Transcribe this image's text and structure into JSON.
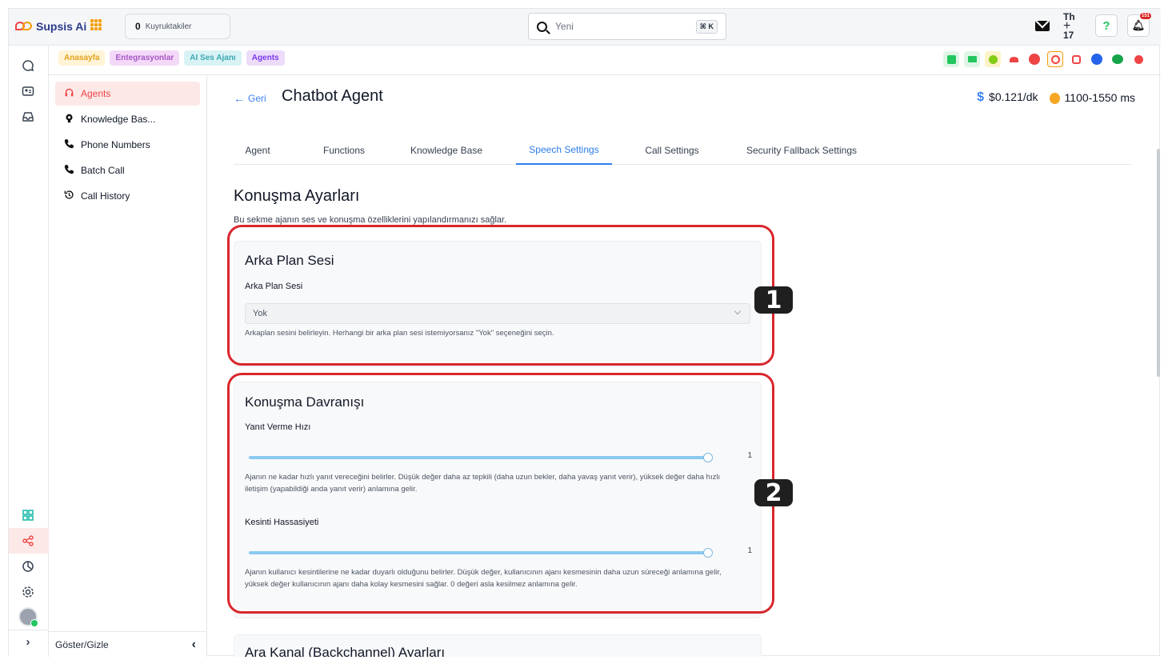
{
  "header": {
    "app_name": "Supsis Ai",
    "queue_count": "0",
    "queue_label": "Kuyruktakiler",
    "search_placeholder": "Yeni",
    "search_shortcut": "⌘ K",
    "calendar_day": "Th",
    "calendar_date": "17",
    "notification_count": "151"
  },
  "breadcrumbs": [
    "Anasayfa",
    "Entegrasyonlar",
    "AI Ses Ajanı",
    "Agents"
  ],
  "sidebar": {
    "items": [
      {
        "label": "Agents",
        "icon": "headset-icon"
      },
      {
        "label": "Knowledge Bas...",
        "icon": "brain-icon"
      },
      {
        "label": "Phone Numbers",
        "icon": "phone-icon"
      },
      {
        "label": "Batch Call",
        "icon": "phone-icon"
      },
      {
        "label": "Call History",
        "icon": "history-icon"
      }
    ],
    "toggle_label": "Göster/Gizle"
  },
  "page": {
    "back_label": "Geri",
    "title": "Chatbot Agent",
    "price": "$0.121/dk",
    "latency": "1100-1550 ms"
  },
  "tabs": [
    "Agent",
    "Functions",
    "Knowledge Base",
    "Speech Settings",
    "Call Settings",
    "Security Fallback Settings"
  ],
  "active_tab": "Speech Settings",
  "section": {
    "title": "Konuşma Ayarları",
    "description": "Bu sekme ajanın ses ve konuşma özelliklerini yapılandırmanızı sağlar."
  },
  "background_sound": {
    "title": "Arka Plan Sesi",
    "label": "Arka Plan Sesi",
    "value": "Yok",
    "help": "Arkaplan sesini belirleyin. Herhangi bir arka plan sesi istemiyorsanız \"Yok\" seçeneğini seçin."
  },
  "speech_behavior": {
    "title": "Konuşma Davranışı",
    "response_speed_label": "Yanıt Verme Hızı",
    "response_speed_value": "1",
    "response_speed_help": "Ajanın ne kadar hızlı yanıt vereceğini belirler. Düşük değer daha az tepkili (daha uzun bekler, daha yavaş yanıt verir), yüksek değer daha hızlı iletişim (yapabildiği anda yanıt verir) anlamına gelir.",
    "interruption_label": "Kesinti Hassasiyeti",
    "interruption_value": "1",
    "interruption_help": "Ajanın kullanıcı kesintilerine ne kadar duyarlı olduğunu belirler. Düşük değer, kullanıcının ajanı kesmesinin daha uzun süreceği anlamına gelir, yüksek değer kullanıcının ajanı daha kolay kesmesini sağlar. 0 değeri asla kesilmez anlamına gelir."
  },
  "backchannel": {
    "title": "Ara Kanal (Backchannel) Ayarları"
  },
  "annotations": [
    "1",
    "2"
  ]
}
